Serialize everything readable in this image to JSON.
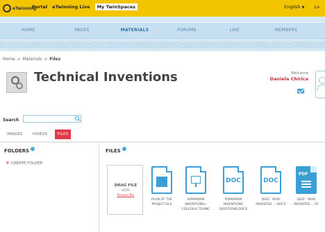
{
  "topbar": {
    "logo_text": "eTwinning",
    "links": [
      "Portal",
      "eTwinning Live",
      "My TwinSpaces"
    ],
    "language": "English",
    "right_fragment": "Lo"
  },
  "nav": {
    "items": [
      "HOME",
      "PAGES",
      "MATERIALS",
      "FORUMS",
      "LIVE",
      "MEMBERS"
    ],
    "active": "MATERIALS"
  },
  "breadcrumb": {
    "home": "Home",
    "sep": ">",
    "materials": "Materials",
    "current": "Files"
  },
  "title": "Technical Inventions",
  "welcome": {
    "label": "Welcome",
    "name": "Daniela Chirica"
  },
  "search": {
    "label": "Search",
    "placeholder": ""
  },
  "tabs": [
    "IMAGES",
    "VIDEOS",
    "FILES"
  ],
  "folders": {
    "title": "FOLDERS",
    "create_label": "CREATE FOLDER"
  },
  "files": {
    "title": "FILES",
    "drag": {
      "line1": "DRAG FILE",
      "line2": "HERE",
      "line3": "Browse file"
    },
    "items": [
      {
        "name_l1": "PLAN OF THE",
        "name_l2": "PROJECT.XLS",
        "icon": "spreadsheet-icon",
        "glyph": ""
      },
      {
        "name_l1": "ROMANIAN",
        "name_l2": "INVENTIONS+",
        "name_l3": "COLEGIUL TEHNIC",
        "icon": "presentation-icon",
        "glyph": ""
      },
      {
        "name_l1": "ROMANIAN",
        "name_l2": "INVENTIONS",
        "name_l3": "QUESTIONS.DOCX",
        "icon": "doc-icon",
        "glyph": "DOC"
      },
      {
        "name_l1": "QUIZ - WHO",
        "name_l2": "INVENTED ....DOCX",
        "icon": "doc-icon",
        "glyph": "DOC"
      },
      {
        "name_l1": "QUIZ - WHO",
        "name_l2": "INVENTED ....P1",
        "icon": "pdf-icon",
        "glyph": "PDF"
      }
    ]
  },
  "colors": {
    "topbar": "#f3c400",
    "nav": "#c7e0f1",
    "accent_red": "#e23a4a",
    "file_blue": "#3a9fd6"
  }
}
